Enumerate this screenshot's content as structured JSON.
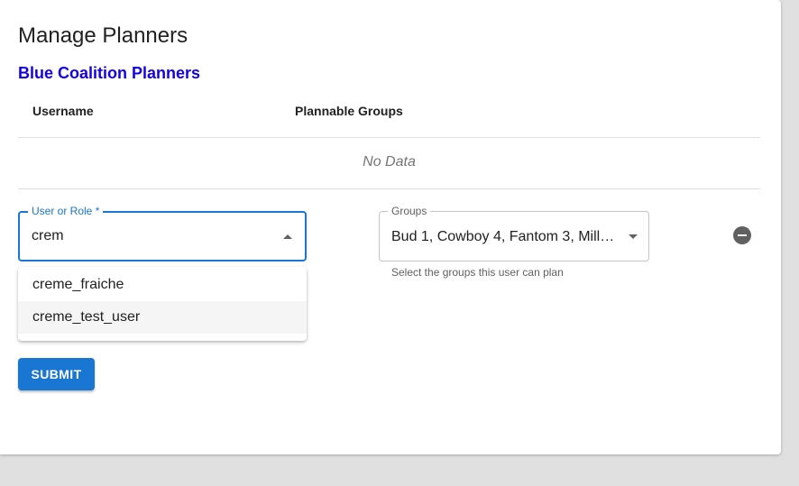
{
  "page": {
    "title": "Manage Planners",
    "section_title": "Blue Coalition Planners"
  },
  "table": {
    "columns": [
      "Username",
      "Plannable Groups"
    ],
    "empty_text": "No Data"
  },
  "form": {
    "user_field": {
      "label": "User or Role *",
      "value": "crem",
      "options": [
        "creme_fraiche",
        "creme_test_user"
      ],
      "highlighted_option": "creme_test_user"
    },
    "groups_field": {
      "label": "Groups",
      "value": "Bud 1, Cowboy 4, Fantom 3, Mille…",
      "helper": "Select the groups this user can plan"
    },
    "remove_icon": "remove-circle-icon",
    "submit_label": "SUBMIT"
  },
  "colors": {
    "section_title": "#1400e6",
    "primary": "#1976d2",
    "background": "#e0e0e0"
  }
}
